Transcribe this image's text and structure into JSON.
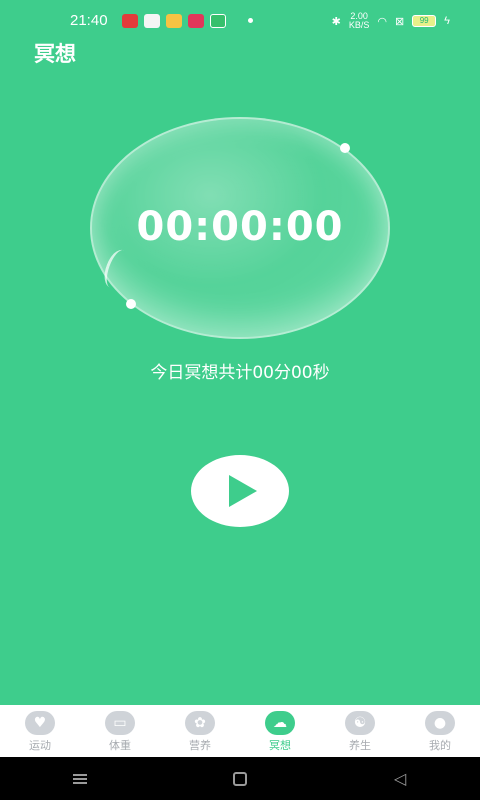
{
  "status_bar": {
    "time": "21:40",
    "net_speed_value": "2.00",
    "net_speed_unit": "KB/S",
    "battery": "99"
  },
  "header": {
    "title": "冥想"
  },
  "meditation": {
    "timer": "00:00:00",
    "summary": "今日冥想共计00分00秒"
  },
  "tabs": [
    {
      "label": "运动",
      "icon": "heartbeat-icon"
    },
    {
      "label": "体重",
      "icon": "scale-icon"
    },
    {
      "label": "营养",
      "icon": "flower-icon"
    },
    {
      "label": "冥想",
      "icon": "brain-icon"
    },
    {
      "label": "养生",
      "icon": "yin-yang-icon"
    },
    {
      "label": "我的",
      "icon": "person-icon"
    }
  ],
  "active_tab": "冥想",
  "colors": {
    "accent": "#3ecd8c",
    "inactive": "#a7abb0"
  }
}
